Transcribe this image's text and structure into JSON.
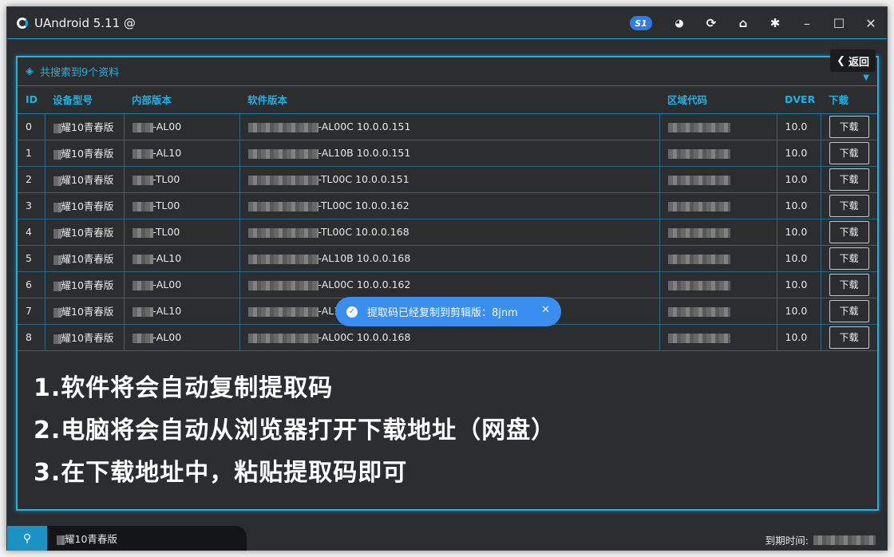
{
  "window": {
    "title": "UAndroid 5.11 @",
    "badge": "S1",
    "icons": [
      "globe-icon",
      "refresh-icon",
      "home-icon",
      "gear-icon",
      "minimize-icon",
      "maximize-icon",
      "close-icon"
    ]
  },
  "panel": {
    "title": "共搜索到9个资料",
    "back_label": "返回"
  },
  "table": {
    "headers": [
      "ID",
      "设备型号",
      "内部版本",
      "软件版本",
      "区域代码",
      "DVER",
      "下载"
    ],
    "rows": [
      {
        "id": "0",
        "model": "耀10青春版",
        "inner": "-AL00",
        "soft": "-AL00C 10.0.0.151",
        "dver": "10.0",
        "btn": "下载"
      },
      {
        "id": "1",
        "model": "耀10青春版",
        "inner": "-AL10",
        "soft": "-AL10B 10.0.0.151",
        "dver": "10.0",
        "btn": "下载"
      },
      {
        "id": "2",
        "model": "耀10青春版",
        "inner": "-TL00",
        "soft": "-TL00C 10.0.0.151",
        "dver": "10.0",
        "btn": "下载"
      },
      {
        "id": "3",
        "model": "耀10青春版",
        "inner": "-TL00",
        "soft": "-TL00C 10.0.0.162",
        "dver": "10.0",
        "btn": "下载"
      },
      {
        "id": "4",
        "model": "耀10青春版",
        "inner": "-TL00",
        "soft": "-TL00C 10.0.0.168",
        "dver": "10.0",
        "btn": "下载"
      },
      {
        "id": "5",
        "model": "耀10青春版",
        "inner": "-AL10",
        "soft": "-AL10B 10.0.0.168",
        "dver": "10.0",
        "btn": "下载"
      },
      {
        "id": "6",
        "model": "耀10青春版",
        "inner": "-AL00",
        "soft": "-AL00C 10.0.0.162",
        "dver": "10.0",
        "btn": "下载"
      },
      {
        "id": "7",
        "model": "耀10青春版",
        "inner": "-AL10",
        "soft": "-AL1",
        "dver": "10.0",
        "btn": "下载"
      },
      {
        "id": "8",
        "model": "耀10青春版",
        "inner": "-AL00",
        "soft": "-AL00C 10.0.0.168",
        "dver": "10.0",
        "btn": "下载"
      }
    ]
  },
  "instructions": [
    "1.软件将会自动复制提取码",
    "2.电脑将会自动从浏览器打开下载地址（网盘）",
    "3.在下载地址中，粘贴提取码即可"
  ],
  "toast": {
    "message": "提取码已经复制到剪辑版：8jnm",
    "close": "✕"
  },
  "bottom": {
    "search_value": "耀10青春版",
    "expiry_label": "到期时间:"
  },
  "colors": {
    "accent": "#1fb2e6",
    "toast": "#3a8ef0",
    "background": "#2b2d2f"
  }
}
